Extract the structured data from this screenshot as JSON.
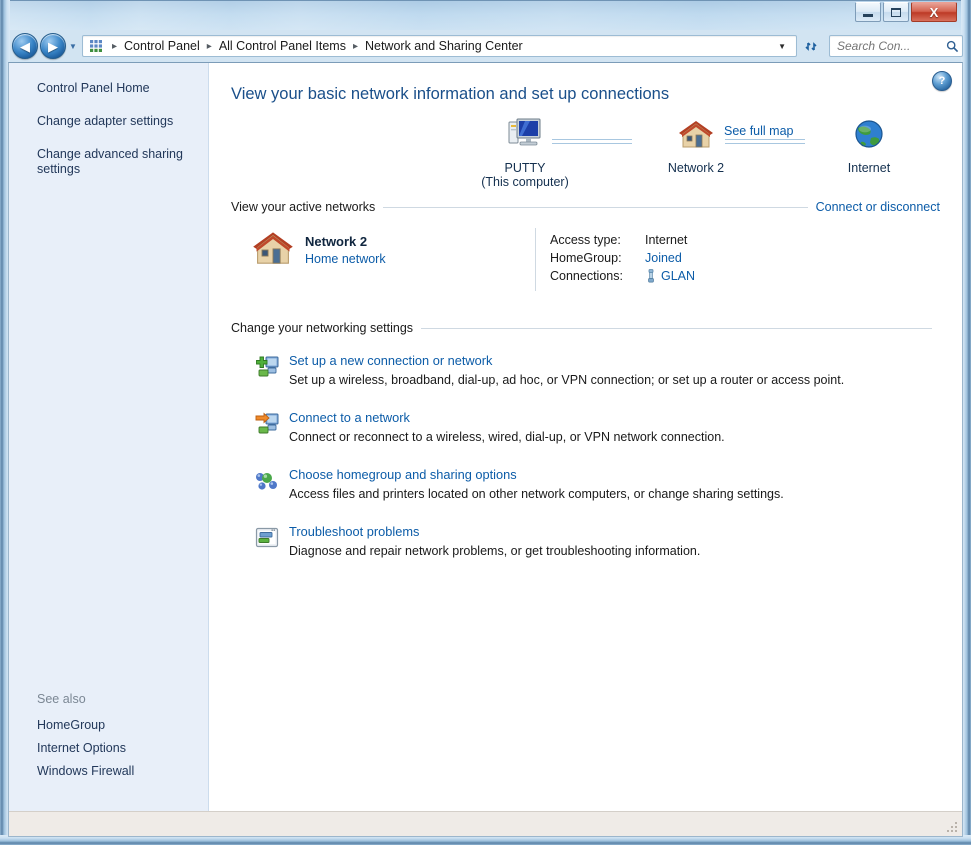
{
  "window": {
    "minimize_label": "Minimize",
    "maximize_label": "Maximize",
    "close_label": "X"
  },
  "navbar": {
    "back_glyph": "◀",
    "forward_glyph": "▶",
    "history_glyph": "▼",
    "addr_icon_name": "control-panel-icon",
    "breadcrumbs": [
      "Control Panel",
      "All Control Panel Items",
      "Network and Sharing Center"
    ],
    "separator": "▸",
    "dropdown_glyph": "▼",
    "refresh_glyph": "↺",
    "search_placeholder": "Search Con...",
    "search_value": "",
    "search_icon": "🔍"
  },
  "sidebar": {
    "items": [
      {
        "label": "Control Panel Home"
      },
      {
        "label": "Change adapter settings"
      },
      {
        "label": "Change advanced sharing settings"
      }
    ],
    "see_also_label": "See also",
    "see_also_items": [
      {
        "label": "HomeGroup"
      },
      {
        "label": "Internet Options"
      },
      {
        "label": "Windows Firewall"
      }
    ]
  },
  "main": {
    "help_glyph": "?",
    "title": "View your basic network information and set up connections",
    "map": {
      "nodes": [
        {
          "name": "PUTTY",
          "sub": "(This computer)",
          "icon": "computer-icon"
        },
        {
          "name": "Network  2",
          "sub": "",
          "icon": "house-icon"
        },
        {
          "name": "Internet",
          "sub": "",
          "icon": "globe-icon"
        }
      ],
      "see_full_map": "See full map"
    },
    "active_networks": {
      "heading": "View your active networks",
      "action_link": "Connect or disconnect",
      "network_name": "Network  2",
      "network_type": "Home network",
      "details": [
        {
          "label": "Access type:",
          "value": "Internet",
          "is_link": false,
          "icon": ""
        },
        {
          "label": "HomeGroup:",
          "value": "Joined",
          "is_link": true,
          "icon": ""
        },
        {
          "label": "Connections:",
          "value": "GLAN",
          "is_link": true,
          "icon": "network-cable-icon"
        }
      ]
    },
    "settings": {
      "heading": "Change your networking settings",
      "actions": [
        {
          "icon": "new-connection-icon",
          "title": "Set up a new connection or network",
          "desc": "Set up a wireless, broadband, dial-up, ad hoc, or VPN connection; or set up a router or access point."
        },
        {
          "icon": "connect-network-icon",
          "title": "Connect to a network",
          "desc": "Connect or reconnect to a wireless, wired, dial-up, or VPN network connection."
        },
        {
          "icon": "homegroup-icon",
          "title": "Choose homegroup and sharing options",
          "desc": "Access files and printers located on other network computers, or change sharing settings."
        },
        {
          "icon": "troubleshoot-icon",
          "title": "Troubleshoot problems",
          "desc": "Diagnose and repair network problems, or get troubleshooting information."
        }
      ]
    }
  },
  "statusbar": {
    "text": ""
  },
  "colors": {
    "link": "#0c5ca8",
    "title": "#1a4f8a",
    "sidebar_bg": "#e8eff9",
    "frame": "#c6dcef",
    "close_button": "#bd3a26"
  }
}
